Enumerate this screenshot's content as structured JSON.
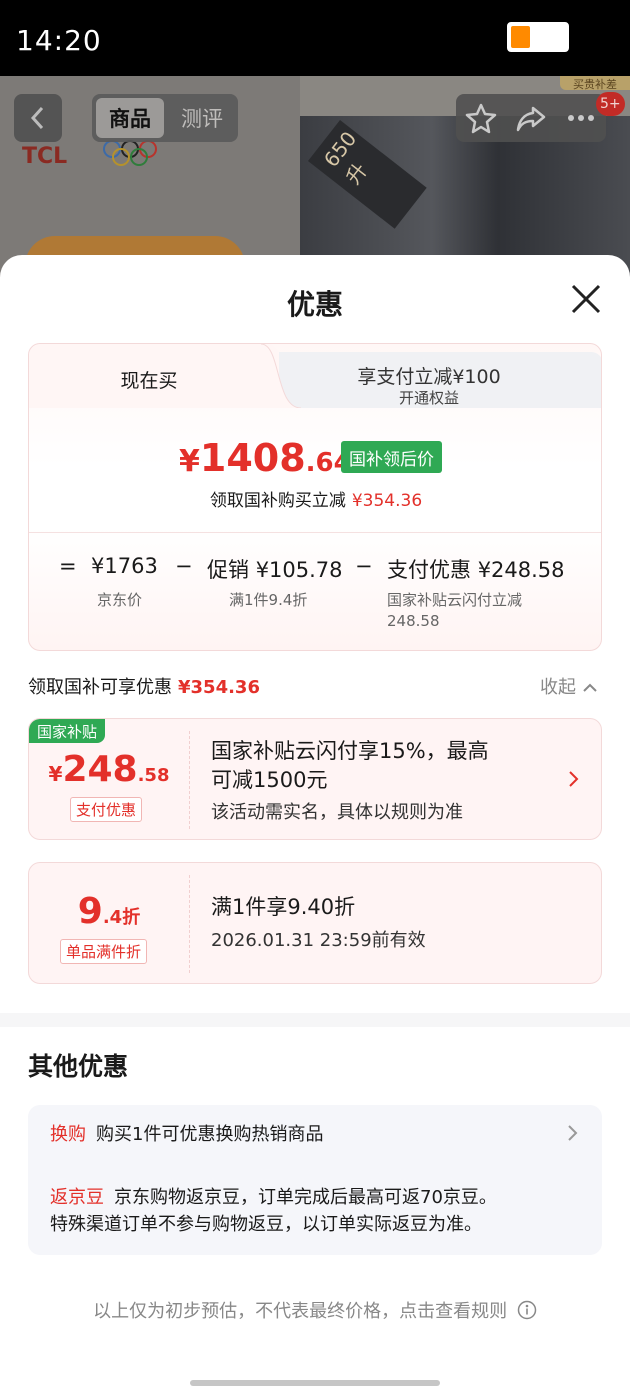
{
  "status": {
    "time": "14:20",
    "battery_level": 0.35,
    "battery_color": "#ff8a00"
  },
  "background": {
    "brand": "TCL",
    "tabs": [
      "商品",
      "测评"
    ],
    "active_tab": "商品",
    "fridge_tag": "650升",
    "corner_tag": "买贵补差",
    "cart_badge": "5+"
  },
  "sheet": {
    "title": "优惠",
    "tabs": {
      "now": "现在买",
      "pay_title": "享支付立减¥100",
      "pay_sub": "开通权益"
    },
    "price": {
      "currency": "¥",
      "int": "1408",
      "dec": ".64",
      "tag": "国补领后价"
    },
    "reduce": {
      "label": "领取国补购买立减",
      "value": "¥354.36"
    },
    "calc": [
      {
        "op": "=",
        "label": "",
        "value": "¥1763",
        "sub": "京东价"
      },
      {
        "op": "−",
        "label": "促销",
        "value": "¥105.78",
        "sub": "满1件9.4折"
      },
      {
        "op": "−",
        "label": "支付优惠",
        "value": "¥248.58",
        "sub": "国家补贴云闪付立减 248.58"
      }
    ],
    "coupon_section": {
      "label": "领取国补可享优惠",
      "value": "¥354.36",
      "collapse": "收起"
    },
    "coupons": [
      {
        "tag": "国家补贴",
        "cur": "¥",
        "int": "248",
        "dec": ".58",
        "type": "支付优惠",
        "line1": "国家补贴云闪付享15%，最高",
        "line2": "可减1500元",
        "note": "该活动需实名，具体以规则为准"
      },
      {
        "int": "9",
        "dec": ".4折",
        "type": "单品满件折",
        "line1": "满1件享9.40折",
        "note": "2026.01.31 23:59前有效"
      }
    ],
    "other": {
      "title": "其他优惠",
      "items": [
        {
          "tag": "换购",
          "text": "购买1件可优惠换购热销商品"
        },
        {
          "tag": "返京豆",
          "text": "京东购物返京豆，订单完成后最高可返70京豆。",
          "text2": "特殊渠道订单不参与购物返豆，以订单实际返豆为准。"
        }
      ]
    },
    "footnote": "以上仅为初步预估，不代表最终价格，点击查看规则"
  }
}
